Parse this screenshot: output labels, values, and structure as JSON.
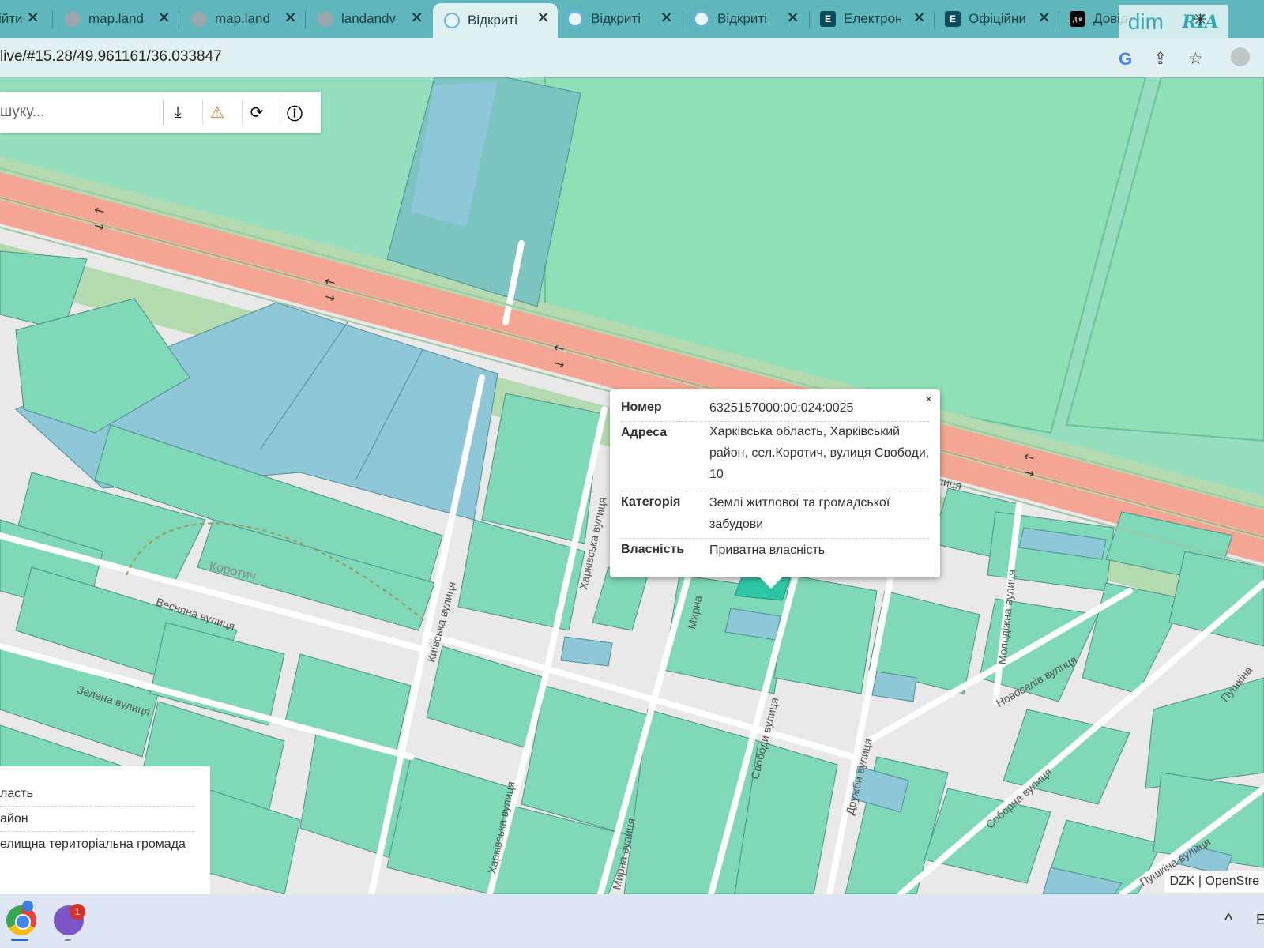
{
  "browser": {
    "tabs": [
      {
        "label": "ійти",
        "favicon": "globe-icon"
      },
      {
        "label": "map.land",
        "favicon": "globe-icon"
      },
      {
        "label": "map.land",
        "favicon": "globe-icon"
      },
      {
        "label": "landandv",
        "favicon": "globe-icon"
      },
      {
        "label": "Відкриті",
        "favicon": "map-app-icon",
        "active": true
      },
      {
        "label": "Відкриті",
        "favicon": "map-app-icon"
      },
      {
        "label": "Відкриті",
        "favicon": "map-app-icon"
      },
      {
        "label": "Електрон",
        "favicon": "e-letter-icon",
        "favicon_text": "E"
      },
      {
        "label": "Офіційни",
        "favicon": "e-letter-icon",
        "favicon_text": "E"
      },
      {
        "label": "Довід",
        "favicon": "diia-icon",
        "favicon_text": "Дія"
      }
    ],
    "url": "live/#15.28/49.961161/36.033847",
    "watermark": {
      "left": "dim",
      "right": "RIA"
    }
  },
  "map": {
    "search_placeholder": "шуку...",
    "tools": [
      "download-icon",
      "warning-icon",
      "refresh-icon",
      "info-icon"
    ],
    "colors": {
      "road": "#f4a593",
      "parcel_green": "#7fd8b8",
      "parcel_blue": "#8dc7d8",
      "background": "#e9e9e9",
      "field": "#8fdfb7"
    },
    "streets": {
      "vesniana": "Весняна вулиця",
      "zelena": "Зелена вулиця",
      "kyivska": "Київська вулиця",
      "kharkivska_n": "Харківська вулиця",
      "kharkivska_s": "Харківська вулиця",
      "myrna_n": "Мирна",
      "myrna_s": "Мирна вулиця",
      "svobody": "Свободи вулиця",
      "druzhby": "Дружби вулиця",
      "molodizhna": "Молодіжна вулиця",
      "novoseliv": "Новоселів вулиця",
      "pushkina": "Пушкіна",
      "soborna": "Соборна вулиця",
      "pushkina_s": "Пушкіна вулиця",
      "kulyts": "улиця",
      "village": "Коротич"
    },
    "popup": {
      "rows": [
        {
          "key": "Номер",
          "value": "6325157000:00:024:0025"
        },
        {
          "key": "Адреса",
          "value": "Харківська область, Харківський район, сел.Коротич, вулиця Свободи, 10"
        },
        {
          "key": "Категорія",
          "value": "Землі житлової та громадської забудови"
        },
        {
          "key": "Власність",
          "value": "Приватна власність"
        }
      ],
      "close": "×"
    },
    "legend": [
      "ласть",
      "айон",
      "елищна територіальна громада"
    ],
    "attribution": "DZK | OpenStre"
  },
  "taskbar": {
    "chrome_badge": "",
    "viber_badge": "1",
    "right_char": "Е"
  }
}
